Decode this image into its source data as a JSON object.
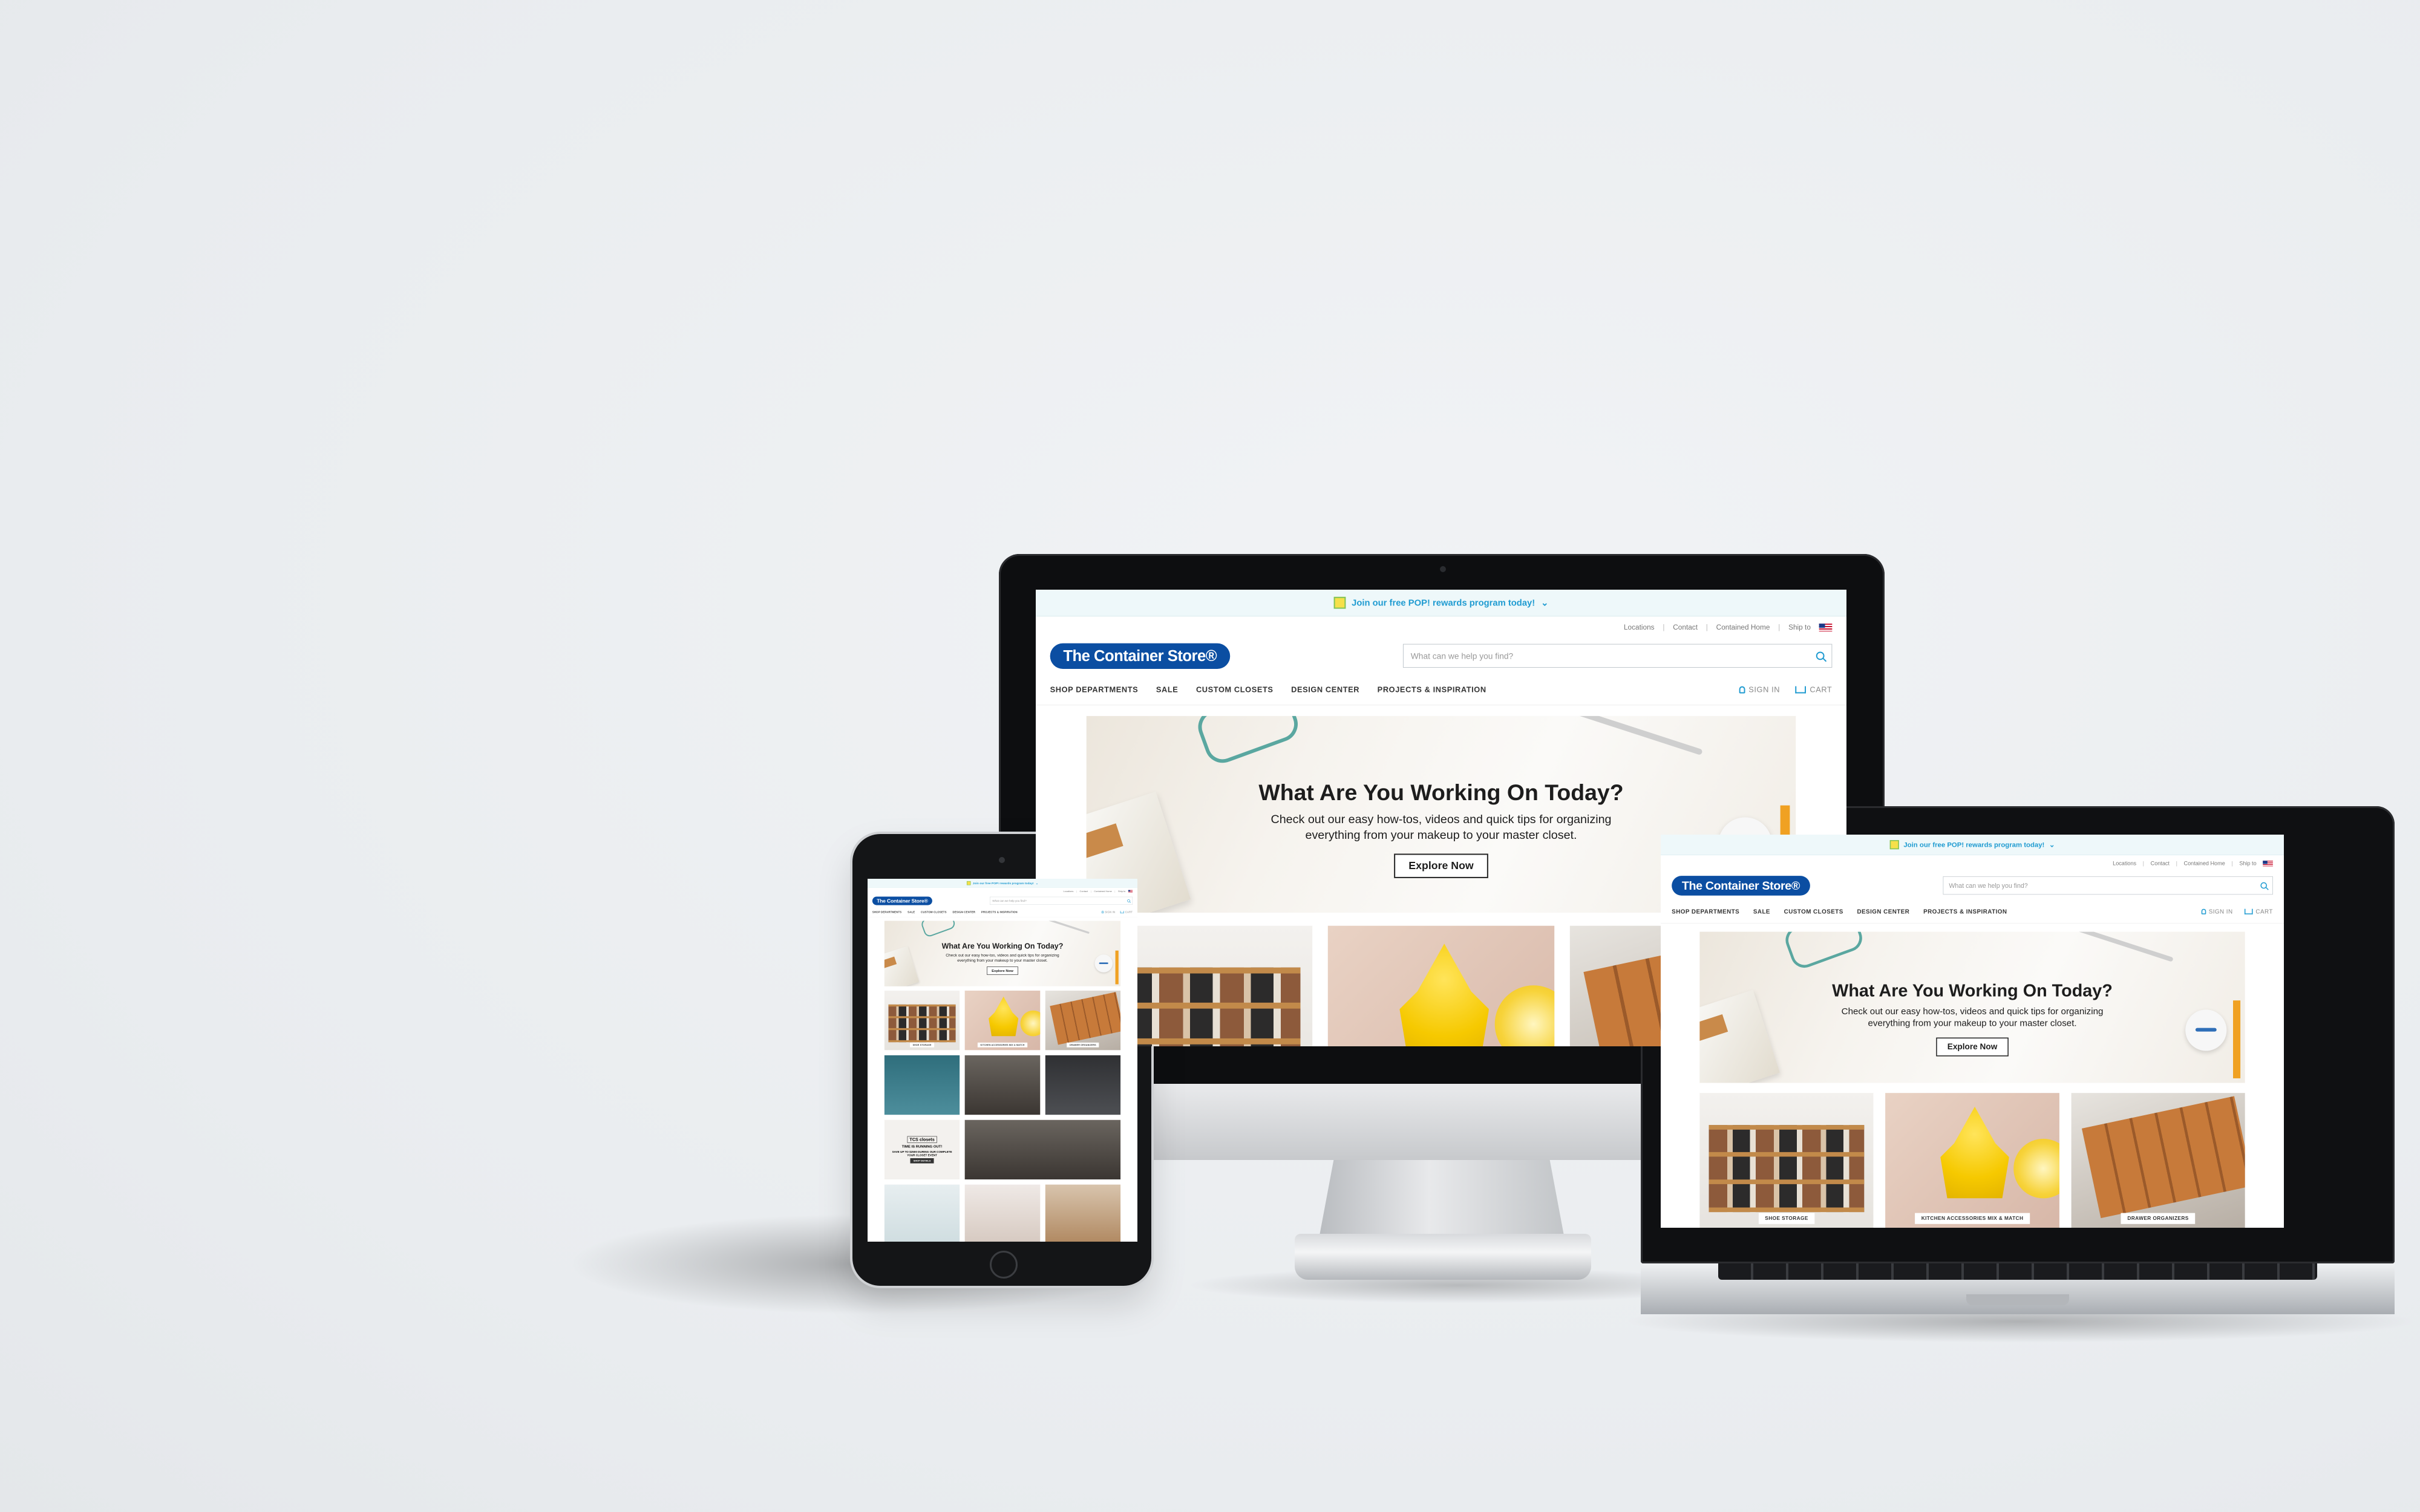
{
  "site": {
    "promo_bar": "Join our free POP! rewards program today!",
    "promo_chevron": "⌄",
    "utility_links": [
      "Locations",
      "Contact",
      "Contained Home",
      "Ship to"
    ],
    "logo": "The Container Store®",
    "search_placeholder": "What can we help you find?",
    "nav": [
      "SHOP DEPARTMENTS",
      "SALE",
      "CUSTOM CLOSETS",
      "DESIGN CENTER",
      "PROJECTS & INSPIRATION"
    ],
    "sign_in": "SIGN IN",
    "cart": "CART",
    "hero": {
      "title": "What Are You Working On Today?",
      "body_line1": "Check out our easy how-tos, videos and quick tips for organizing",
      "body_line2": "everything from your makeup to your master closet.",
      "cta": "Explore Now"
    },
    "tiles": [
      {
        "caption": "SHOE STORAGE"
      },
      {
        "caption": "KITCHEN ACCESSORIES MIX & MATCH"
      },
      {
        "caption": "DRAWER ORGANIZERS"
      }
    ],
    "promo_tile": {
      "logo_text": "TCS closets",
      "headline": "TIME IS RUNNING OUT!",
      "subline": "SAVE UP TO $2500 DURING OUR COMPLETE YOUR CLOSET EVENT",
      "cta": "SHOP DETAILS"
    }
  },
  "devices": [
    "imac",
    "tablet",
    "laptop"
  ],
  "colors": {
    "brand_blue": "#0b4ea2",
    "accent_cyan": "#1f9bd1",
    "background": "#eceff1",
    "device_black": "#0d0e10"
  }
}
